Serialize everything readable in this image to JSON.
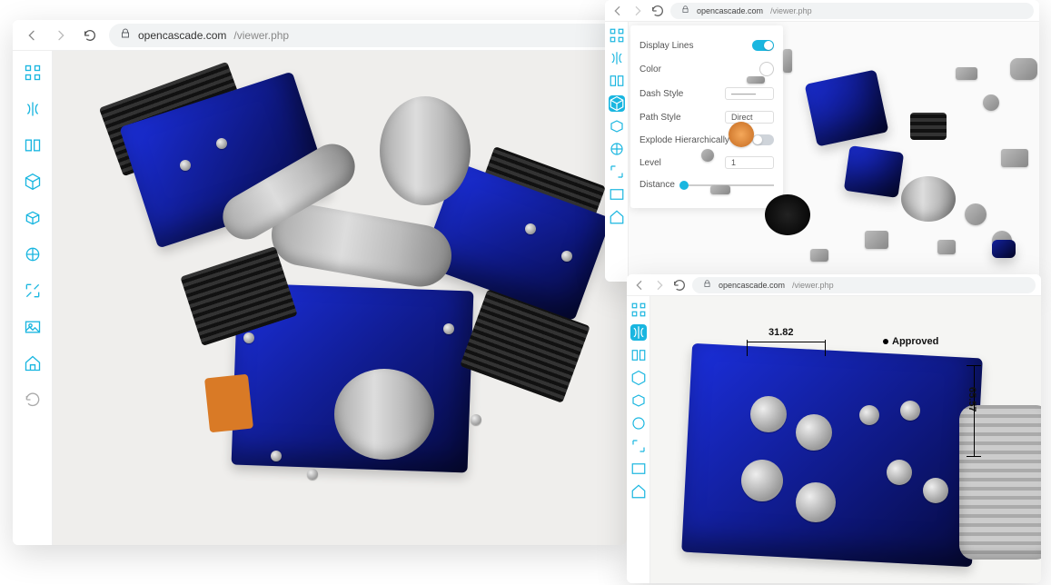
{
  "windows": {
    "main": {
      "url_domain": "opencascade.com",
      "url_path": "/viewer.php"
    },
    "exploded": {
      "url_domain": "opencascade.com",
      "url_path": "/viewer.php",
      "panel": {
        "display_lines_label": "Display Lines",
        "display_lines_on": true,
        "color_label": "Color",
        "dash_style_label": "Dash Style",
        "dash_style_value": "———",
        "path_style_label": "Path Style",
        "path_style_value": "Direct",
        "explode_hierarchically_label": "Explode Hierarchically",
        "explode_hierarchically_on": false,
        "level_label": "Level",
        "level_value": "1",
        "distance_label": "Distance"
      }
    },
    "measure": {
      "url_domain": "opencascade.com",
      "url_path": "/viewer.php",
      "dimensions": {
        "dim1": "31.82",
        "dim2": "65.57",
        "annotation": "Approved"
      }
    }
  },
  "toolbar_icons": [
    "grid-icon",
    "mirror-icon",
    "section-icon",
    "cube-icon",
    "box-icon",
    "layers-icon",
    "expand-icon",
    "image-icon",
    "home-icon",
    "refresh-icon"
  ],
  "toolbar_icons_small": [
    "grid-icon",
    "mirror-icon",
    "section-icon",
    "cube-icon",
    "box-icon",
    "layers-icon",
    "expand-icon",
    "image-icon",
    "home-icon"
  ]
}
